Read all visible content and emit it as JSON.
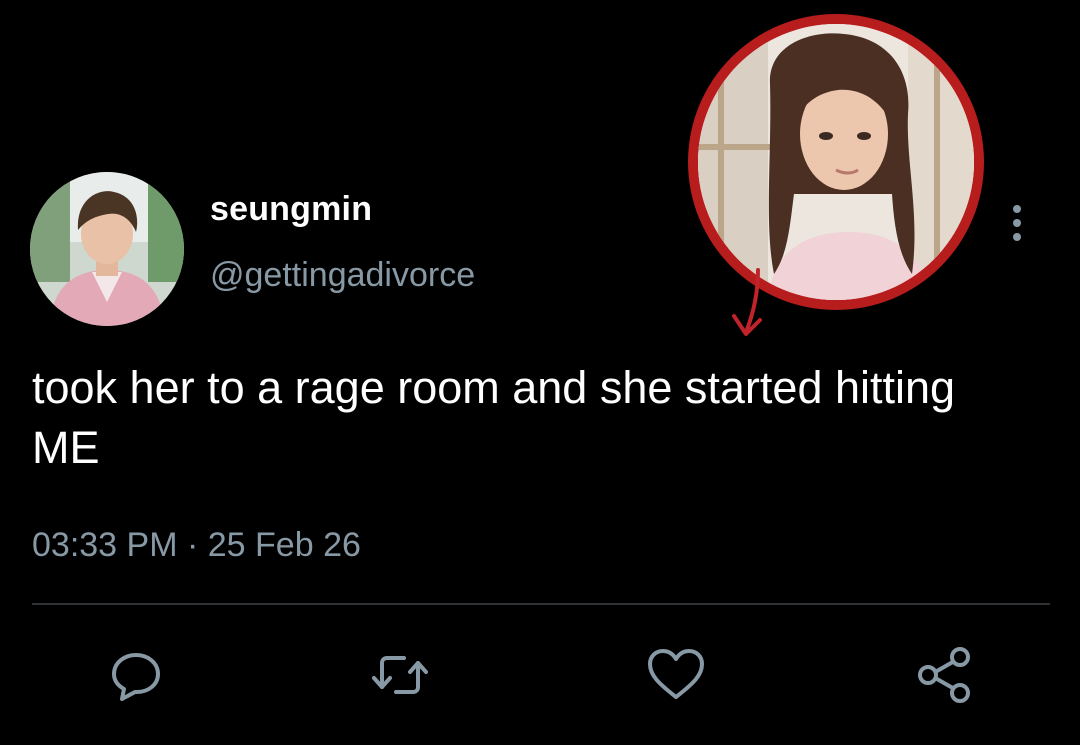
{
  "tweet": {
    "display_name": "seungmin",
    "handle": "@gettingadivorce",
    "text": "took her to a rage room and she started hitting ME",
    "time": "03:33 PM",
    "separator": "·",
    "date": "25 Feb 26"
  },
  "icons": {
    "more": "more-vertical-icon",
    "reply": "reply-icon",
    "retweet": "retweet-icon",
    "like": "heart-icon",
    "share": "share-icon"
  },
  "colors": {
    "background": "#000000",
    "text": "#ffffff",
    "secondary_text": "#8899a6",
    "divider": "#2f3336",
    "highlight_ring": "#b81d1d"
  }
}
